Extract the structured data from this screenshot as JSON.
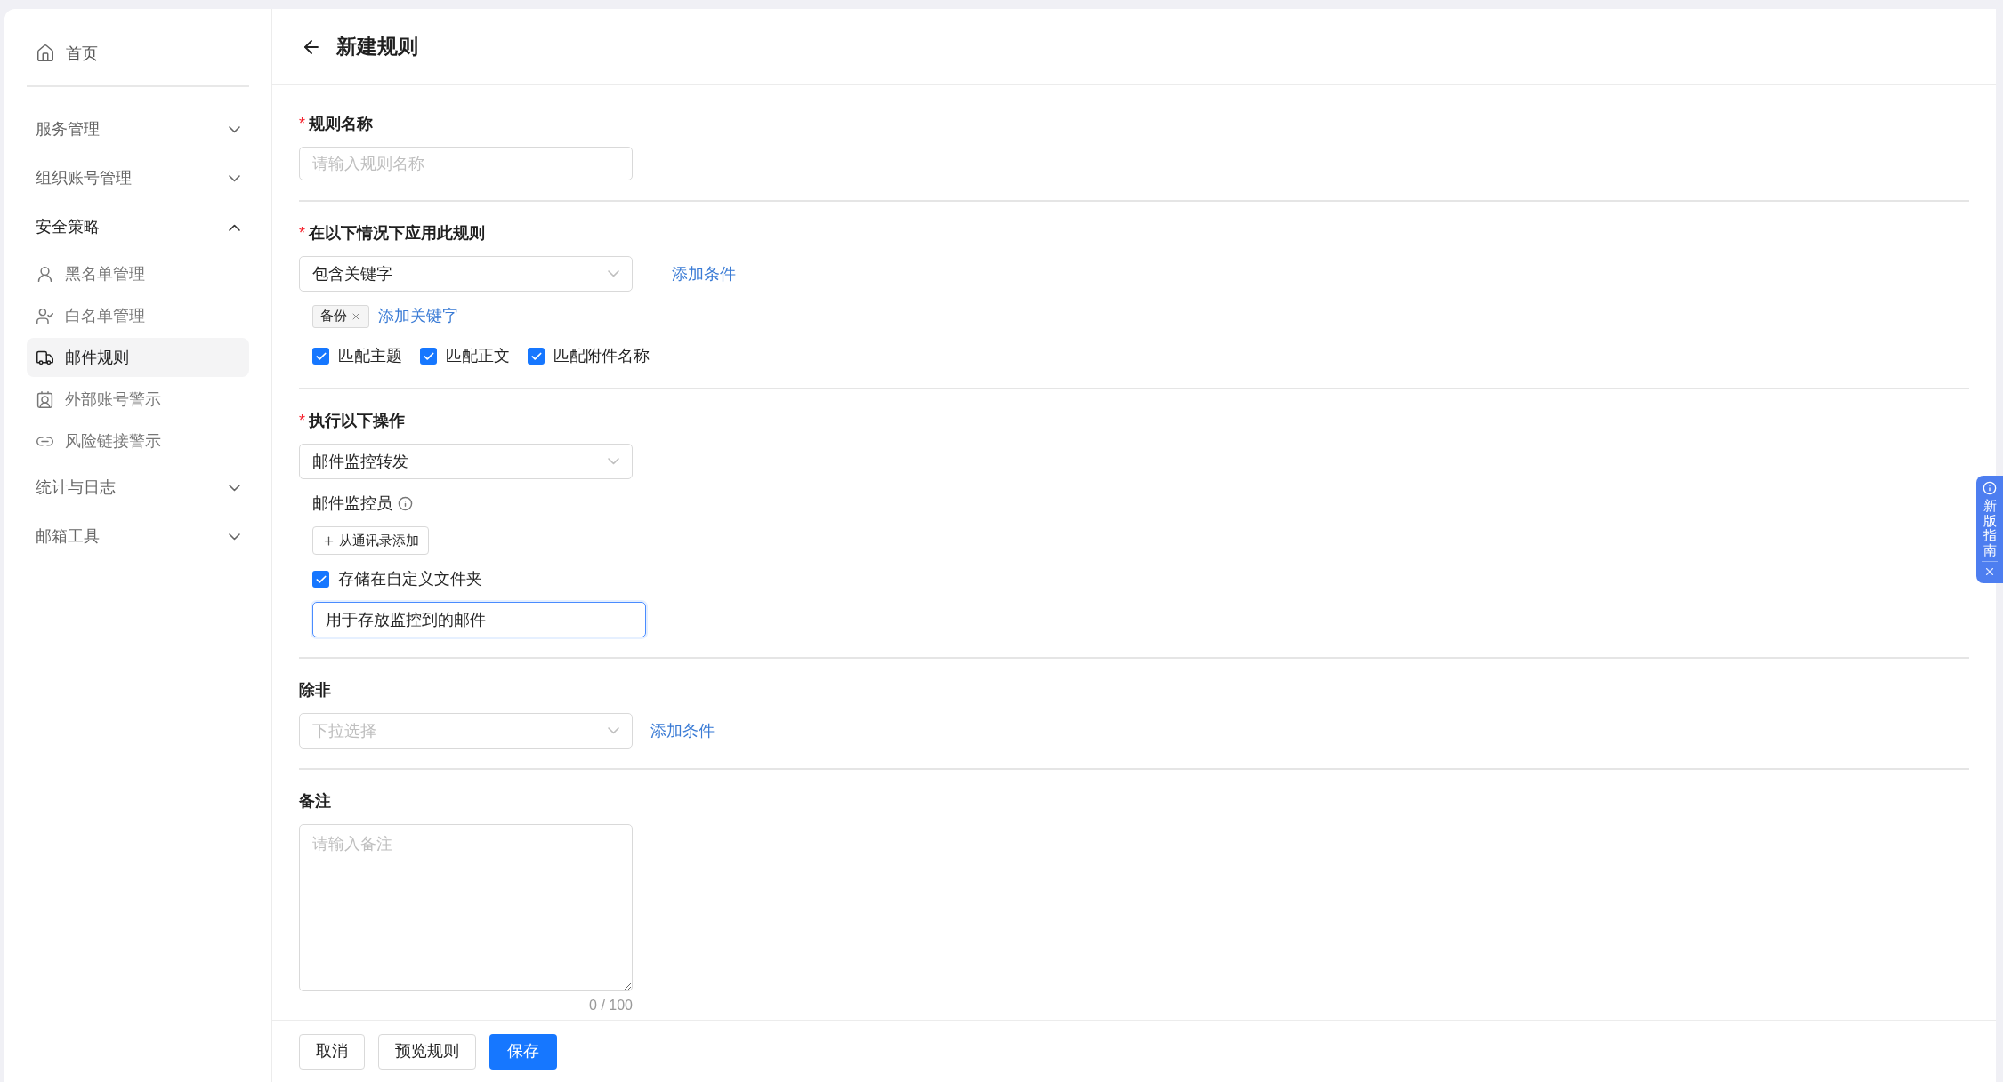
{
  "sidebar": {
    "home": {
      "label": "首页"
    },
    "groups": [
      {
        "label": "服务管理",
        "expanded": false
      },
      {
        "label": "组织账号管理",
        "expanded": false
      },
      {
        "label": "安全策略",
        "expanded": true,
        "children": [
          {
            "label": "黑名单管理",
            "selected": false
          },
          {
            "label": "白名单管理",
            "selected": false
          },
          {
            "label": "邮件规则",
            "selected": true
          },
          {
            "label": "外部账号警示",
            "selected": false
          },
          {
            "label": "风险链接警示",
            "selected": false
          }
        ]
      },
      {
        "label": "统计与日志",
        "expanded": false
      },
      {
        "label": "邮箱工具",
        "expanded": false
      }
    ]
  },
  "header": {
    "title": "新建规则"
  },
  "name_field": {
    "label": "规则名称",
    "required_mark": "*",
    "placeholder": "请输入规则名称"
  },
  "condition": {
    "label": "在以下情况下应用此规则",
    "required_mark": "*",
    "select": {
      "value": "包含关键字"
    },
    "add_condition": "添加条件",
    "keywords": [
      {
        "label": "备份"
      }
    ],
    "add_keyword": "添加关键字",
    "options": [
      {
        "label": "匹配主题",
        "checked": true
      },
      {
        "label": "匹配正文",
        "checked": true
      },
      {
        "label": "匹配附件名称",
        "checked": true
      }
    ]
  },
  "action": {
    "label": "执行以下操作",
    "required_mark": "*",
    "select": {
      "value": "邮件监控转发"
    },
    "monitor_label": "邮件监控员",
    "add_from_contacts": "从通讯录添加",
    "store_option": {
      "label": "存储在自定义文件夹",
      "checked": true
    },
    "folder_input": {
      "value": "用于存放监控到的邮件"
    }
  },
  "except": {
    "label": "除非",
    "select": {
      "placeholder": "下拉选择"
    },
    "add_condition": "添加条件"
  },
  "note": {
    "label": "备注",
    "placeholder": "请输入备注",
    "counter": "0 / 100"
  },
  "footer": {
    "buttons": [
      {
        "label": "取消",
        "kind": "default"
      },
      {
        "label": "预览规则",
        "kind": "default"
      },
      {
        "label": "保存",
        "kind": "primary"
      }
    ]
  },
  "guide": {
    "text": "新版指南"
  }
}
